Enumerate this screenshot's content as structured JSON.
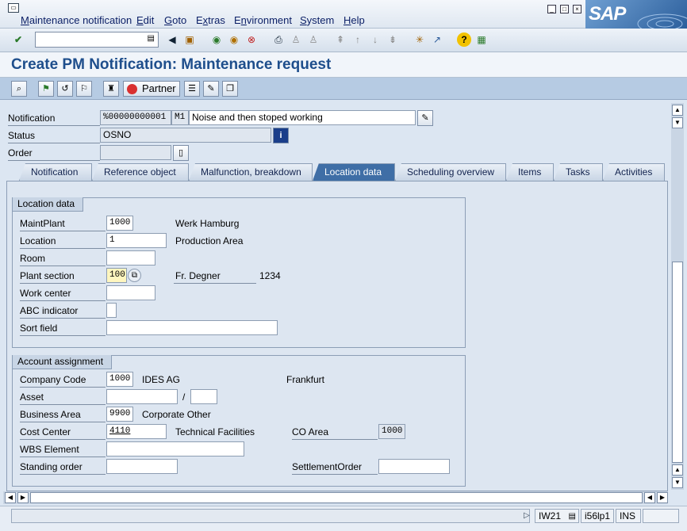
{
  "menu": {
    "items": [
      "Maintenance notification",
      "Edit",
      "Goto",
      "Extras",
      "Environment",
      "System",
      "Help"
    ],
    "underline": [
      "M",
      "E",
      "G",
      "x",
      "n",
      "S",
      "H"
    ]
  },
  "logo": {
    "text": "SAP"
  },
  "window_controls": {
    "minimize": "_",
    "restore": "□",
    "close": "×"
  },
  "title": "Create PM Notification: Maintenance request",
  "app_toolbar": {
    "partner_label": "Partner"
  },
  "header": {
    "notification_label": "Notification",
    "notification_number": "%00000000001",
    "notification_type": "M1",
    "notification_text": "Noise and then stoped working",
    "status_label": "Status",
    "status_value": "OSNO",
    "order_label": "Order",
    "order_value": ""
  },
  "tabs": [
    {
      "label": "Notification",
      "active": false
    },
    {
      "label": "Reference object",
      "active": false
    },
    {
      "label": "Malfunction, breakdown",
      "active": false
    },
    {
      "label": "Location data",
      "active": true
    },
    {
      "label": "Scheduling overview",
      "active": false
    },
    {
      "label": "Items",
      "active": false
    },
    {
      "label": "Tasks",
      "active": false
    },
    {
      "label": "Activities",
      "active": false
    }
  ],
  "location_data": {
    "title": "Location data",
    "maint_plant_label": "MaintPlant",
    "maint_plant_value": "1000",
    "maint_plant_text": "Werk Hamburg",
    "location_label": "Location",
    "location_value": "1",
    "location_text": "Production Area",
    "room_label": "Room",
    "room_value": "",
    "plant_section_label": "Plant section",
    "plant_section_value": "100",
    "plant_section_person": "Fr. Degner",
    "plant_section_phone": "1234",
    "work_center_label": "Work center",
    "work_center_value": "",
    "abc_label": "ABC indicator",
    "abc_value": "",
    "sort_label": "Sort field",
    "sort_value": ""
  },
  "account_assignment": {
    "title": "Account assignment",
    "company_code_label": "Company Code",
    "company_code_value": "1000",
    "company_name": "IDES AG",
    "company_city": "Frankfurt",
    "asset_label": "Asset",
    "asset_value": "",
    "asset_separator": "/",
    "asset_sub": "",
    "business_area_label": "Business Area",
    "business_area_value": "9900",
    "business_area_text": "Corporate Other",
    "cost_center_label": "Cost Center",
    "cost_center_value": "4110",
    "cost_center_text": "Technical Facilities",
    "co_area_label": "CO Area",
    "co_area_value": "1000",
    "wbs_label": "WBS Element",
    "wbs_value": "",
    "standing_order_label": "Standing order",
    "standing_order_value": "",
    "settlement_order_label": "SettlementOrder",
    "settlement_order_value": ""
  },
  "status_bar": {
    "transaction": "IW21",
    "server": "i56lp1",
    "mode": "INS"
  },
  "colors": {
    "title": "#1e4e8c",
    "active_tab": "#3f6ea6",
    "app_toolbar": "#b6cbe3"
  }
}
